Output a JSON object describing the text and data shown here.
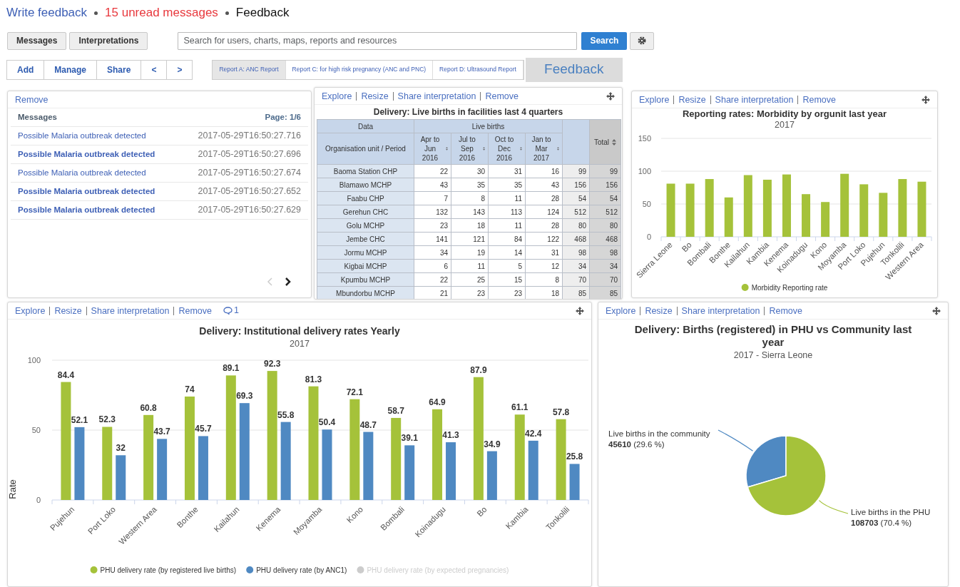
{
  "header": {
    "write_feedback": "Write feedback",
    "unread": "15 unread messages",
    "title": "Feedback"
  },
  "toolbar": {
    "buttons": [
      "Messages",
      "Interpretations"
    ],
    "search": {
      "placeholder": "Search for users, charts, maps, reports and resources"
    },
    "search_button": "Search"
  },
  "dashboard_actions": [
    "Add",
    "Manage",
    "Share",
    "<",
    ">"
  ],
  "report_tabs": [
    {
      "label": "Report A: ANC Report",
      "selected": true
    },
    {
      "label": "Report C: for high risk pregnancy (ANC and PNC)",
      "selected": false
    },
    {
      "label": "Report D: Ultrasound Report",
      "selected": false
    }
  ],
  "overlay_label": "Feedback",
  "messages_panel": {
    "action": "Remove",
    "heading": "Messages",
    "page": "Page: 1/6",
    "messages": [
      {
        "subject": "Possible Malaria outbreak detected",
        "time": "2017-05-29T16:50:27.716",
        "unread": false
      },
      {
        "subject": "Possible Malaria outbreak detected",
        "time": "2017-05-29T16:50:27.696",
        "unread": true
      },
      {
        "subject": "Possible Malaria outbreak detected",
        "time": "2017-05-29T16:50:27.674",
        "unread": false
      },
      {
        "subject": "Possible Malaria outbreak detected",
        "time": "2017-05-29T16:50:27.652",
        "unread": true
      },
      {
        "subject": "Possible Malaria outbreak detected",
        "time": "2017-05-29T16:50:27.629",
        "unread": true
      }
    ],
    "pager": [
      {
        "kind": "prev",
        "disabled": true
      },
      {
        "kind": "next",
        "disabled": false
      }
    ]
  },
  "table_panel": {
    "actions": [
      "Explore",
      "Resize",
      "Share interpretation",
      "Remove"
    ],
    "title": "Delivery: Live births in facilities last 4 quarters",
    "dimension_header": "Data",
    "data_header": "Live births",
    "row_header": "Organisation unit / Period",
    "periods": [
      "Apr to Jun 2016",
      "Jul to Sep 2016",
      "Oct to Dec 2016",
      "Jan to Mar 2017"
    ],
    "total_header": "Total",
    "rows": [
      {
        "name": "Baoma Station CHP",
        "values": [
          "22",
          "30",
          "31",
          "16",
          "99",
          "99"
        ]
      },
      {
        "name": "Blamawo MCHP",
        "values": [
          "43",
          "35",
          "35",
          "43",
          "156",
          "156"
        ]
      },
      {
        "name": "Faabu CHP",
        "values": [
          "7",
          "8",
          "11",
          "28",
          "54",
          "54"
        ]
      },
      {
        "name": "Gerehun CHC",
        "values": [
          "132",
          "143",
          "113",
          "124",
          "512",
          "512"
        ]
      },
      {
        "name": "Golu MCHP",
        "values": [
          "23",
          "18",
          "11",
          "28",
          "80",
          "80"
        ]
      },
      {
        "name": "Jembe CHC",
        "values": [
          "141",
          "121",
          "84",
          "122",
          "468",
          "468"
        ]
      },
      {
        "name": "Jormu MCHP",
        "values": [
          "34",
          "19",
          "14",
          "31",
          "98",
          "98"
        ]
      },
      {
        "name": "Kigbai MCHP",
        "values": [
          "6",
          "11",
          "5",
          "12",
          "34",
          "34"
        ]
      },
      {
        "name": "Kpumbu MCHP",
        "values": [
          "22",
          "25",
          "15",
          "8",
          "70",
          "70"
        ]
      },
      {
        "name": "Mbundorbu MCHP",
        "values": [
          "21",
          "23",
          "23",
          "18",
          "85",
          "85"
        ]
      }
    ]
  },
  "morbidity_panel": {
    "actions": [
      "Explore",
      "Resize",
      "Share interpretation",
      "Remove"
    ],
    "subtitle": "2017",
    "chart_data": {
      "type": "bar",
      "title": "Reporting rates: Morbidity by orgunit last year",
      "categories": [
        "Sierra Leone",
        "Bo",
        "Bombali",
        "Bonthe",
        "Kailahun",
        "Kambia",
        "Kenema",
        "Koinadugu",
        "Kono",
        "Moyamba",
        "Port Loko",
        "Pujehun",
        "Tonkolili",
        "Western Area"
      ],
      "series": [
        {
          "name": "Morbidity Reporting rate",
          "color": "#a5c23a",
          "values": [
            81,
            81,
            88,
            60,
            94,
            87,
            95,
            65,
            53,
            96,
            80,
            67,
            88,
            84
          ]
        }
      ],
      "legend": "bottom",
      "ylim": [
        0,
        150
      ],
      "yticks": [
        0,
        50,
        100,
        150
      ]
    }
  },
  "delivery_panel": {
    "actions": [
      "Explore",
      "Resize",
      "Share interpretation",
      "Remove"
    ],
    "comments": "1",
    "subtitle": "2017",
    "series_toggles": [
      {
        "on": true
      },
      {
        "on": true
      },
      {
        "on": false
      }
    ],
    "chart_data": {
      "type": "bar",
      "title": "Delivery: Institutional delivery rates Yearly",
      "ylabel": "Rate",
      "categories": [
        "Pujehun",
        "Port Loko",
        "Western Area",
        "Bonthe",
        "Kailahun",
        "Kenema",
        "Moyamba",
        "Kono",
        "Bombali",
        "Koinadugu",
        "Bo",
        "Kambia",
        "Tonkolili"
      ],
      "series": [
        {
          "name": "PHU delivery rate (by registered live births)",
          "color": "#a5c23a",
          "values": [
            84.4,
            52.3,
            60.8,
            74,
            89.1,
            92.3,
            81.3,
            72.1,
            58.7,
            64.9,
            87.9,
            61.1,
            57.8
          ]
        },
        {
          "name": "PHU delivery rate (by ANC1)",
          "color": "#4f89c2",
          "values": [
            52.1,
            32,
            43.7,
            45.7,
            69.3,
            55.8,
            50.4,
            48.7,
            39.1,
            41.3,
            34.9,
            42.4,
            25.8
          ]
        },
        {
          "name": "PHU delivery rate (by expected pregnancies)",
          "color": "#cccccc",
          "values": [
            null,
            null,
            null,
            null,
            null,
            null,
            null,
            null,
            null,
            null,
            null,
            null,
            null
          ]
        }
      ],
      "legend": "bottom",
      "ylim": [
        0,
        100
      ],
      "yticks": [
        0,
        50,
        100
      ],
      "data_labels": true
    }
  },
  "pie_panel": {
    "actions": [
      "Explore",
      "Resize",
      "Share interpretation",
      "Remove"
    ],
    "subtitle": "2017 - Sierra Leone",
    "chart_data": {
      "type": "pie",
      "title": "Delivery: Births (registered) in PHU vs Community last year",
      "categories": [
        "Live births in the community",
        "Live births in the PHU"
      ],
      "series": [
        {
          "values": [
            29.6,
            70.4
          ]
        }
      ],
      "colors": [
        "#4f89c2",
        "#a5c23a"
      ],
      "value_labels": [
        "**45610** (29.6 %)",
        "**108703** (70.4 %)"
      ]
    }
  }
}
